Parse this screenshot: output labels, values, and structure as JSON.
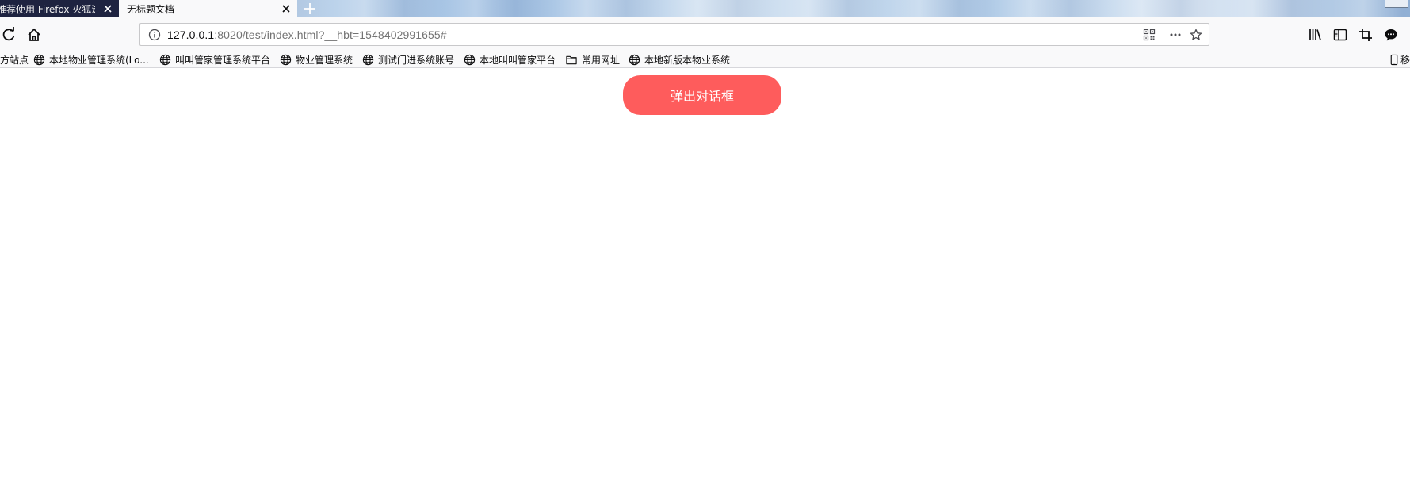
{
  "tabs": [
    {
      "title": "推荐使用 Firefox 火狐浏览器",
      "active": false
    },
    {
      "title": "无标题文档",
      "active": true
    }
  ],
  "new_tab_icon": "plus-icon",
  "urlbar": {
    "host": "127.0.0.1",
    "rest": ":8020/test/index.html?__hbt=1548402991655#",
    "icons": [
      "info-icon",
      "qr-code-icon",
      "more-actions-icon",
      "star-icon"
    ]
  },
  "nav_icons": [
    "reload-icon",
    "home-icon"
  ],
  "toolbar_icons": [
    "library-icon",
    "sidebar-icon",
    "screenshot-icon",
    "chat-icon"
  ],
  "bookmarks": [
    {
      "label": "方站点",
      "icon": "none"
    },
    {
      "label": "本地物业管理系统(Lo...",
      "icon": "globe-icon"
    },
    {
      "label": "叫叫管家管理系统平台",
      "icon": "globe-icon"
    },
    {
      "label": "物业管理系统",
      "icon": "globe-icon"
    },
    {
      "label": "测试门进系统账号",
      "icon": "globe-icon"
    },
    {
      "label": "本地叫叫管家平台",
      "icon": "globe-icon"
    },
    {
      "label": "常用网址",
      "icon": "folder-icon"
    },
    {
      "label": "本地新版本物业系统",
      "icon": "globe-icon"
    }
  ],
  "bookmarks_right": {
    "label": "移",
    "icon": "mobile-icon"
  },
  "page": {
    "button_label": "弹出对话框",
    "button_color": "#fe5c5c"
  }
}
